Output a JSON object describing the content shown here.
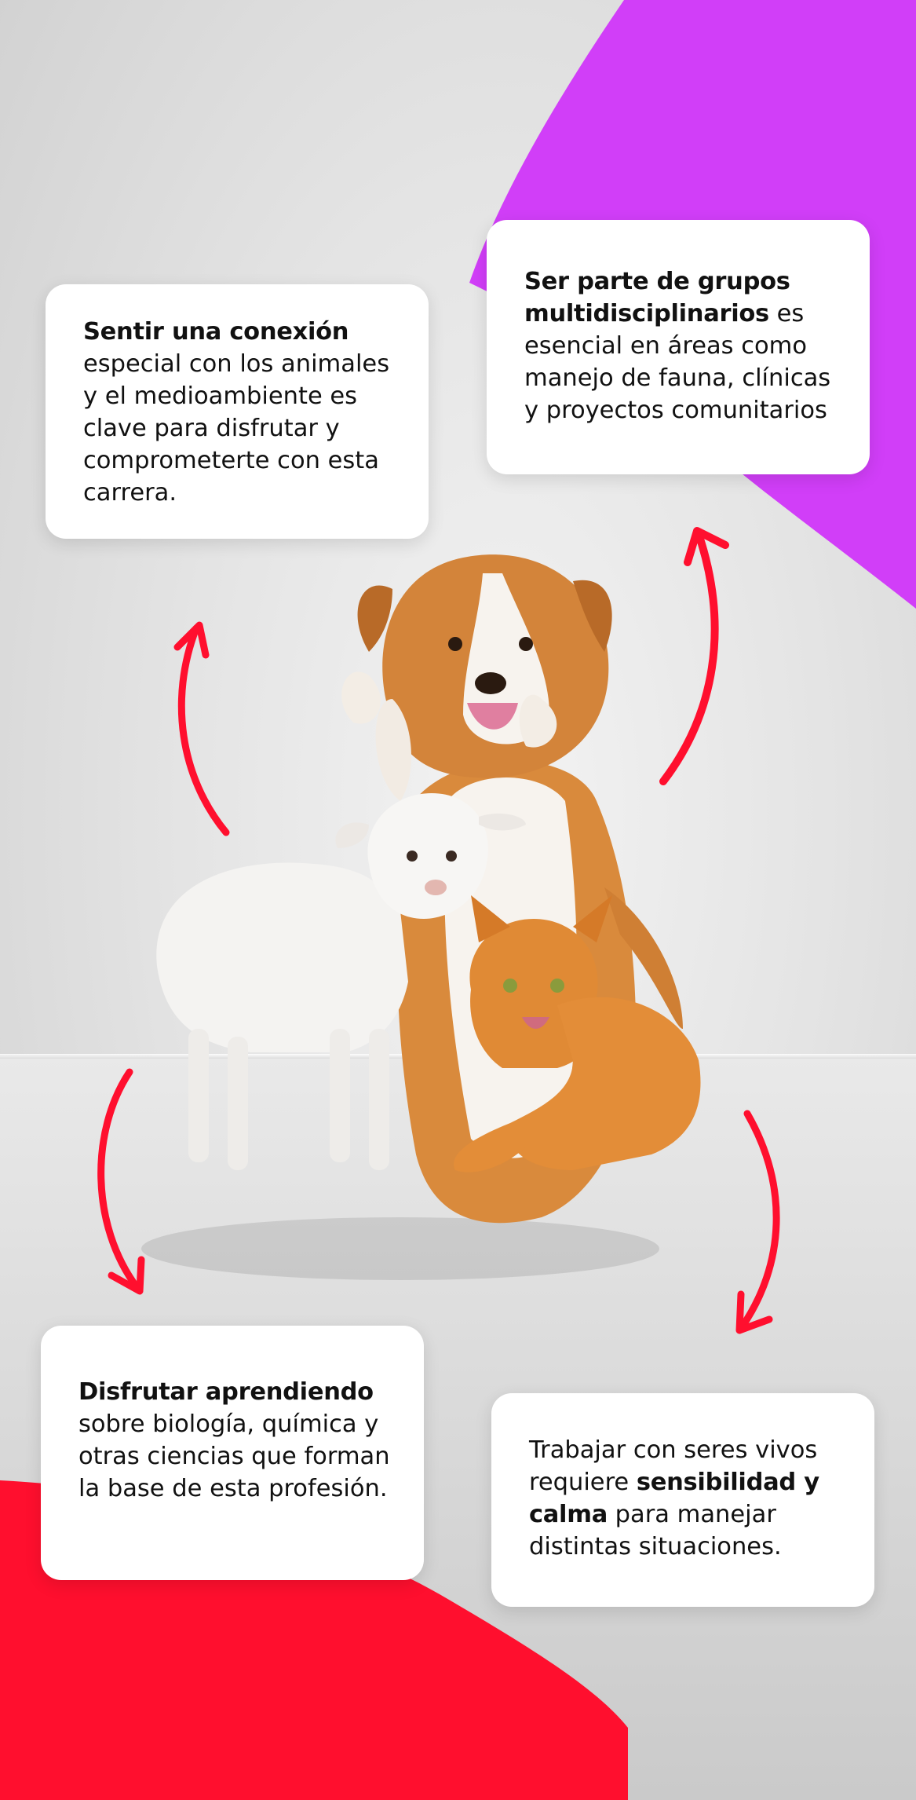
{
  "colors": {
    "purple_accent": "#d13ef8",
    "red_accent": "#ff0f2e",
    "card_background": "#ffffff",
    "text": "#111111"
  },
  "cards": [
    {
      "bold": "Sentir una conexión",
      "rest": "especial con los animales y el medioambiente es clave para disfrutar y comprometerte con esta carrera."
    },
    {
      "bold": "Ser parte de grupos multidisciplinarios",
      "rest": " es esencial en áreas como manejo de fauna, clínicas y proyectos comunitarios"
    },
    {
      "bold": "Disfrutar aprendiendo",
      "rest": "sobre biología, química y otras ciencias que forman la base de esta profesión."
    },
    {
      "before": "Trabajar con seres vivos requiere ",
      "bold": "sensibilidad y calma",
      "rest": " para manejar distintas situaciones."
    }
  ],
  "illustration": {
    "subjects": [
      "dog-icon",
      "lamb-icon",
      "cat-icon"
    ],
    "arrows": [
      "arrow-up-left-icon",
      "arrow-up-right-icon",
      "arrow-down-left-icon",
      "arrow-down-right-icon"
    ]
  }
}
